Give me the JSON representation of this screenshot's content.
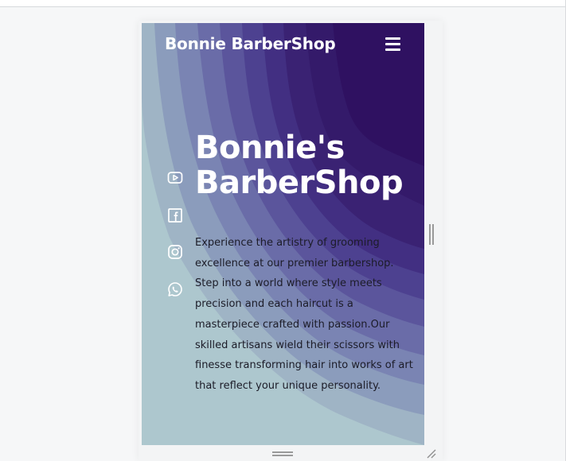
{
  "navbar": {
    "brand": "Bonnie BarberShop",
    "menu_icon": "hamburger-menu-icon"
  },
  "social": [
    {
      "name": "youtube",
      "icon": "youtube-icon"
    },
    {
      "name": "facebook",
      "icon": "facebook-icon"
    },
    {
      "name": "instagram",
      "icon": "instagram-icon"
    },
    {
      "name": "whatsapp",
      "icon": "whatsapp-icon"
    }
  ],
  "hero": {
    "title_line1": "Bonnie's",
    "title_line2": "BarberShop",
    "description": "Experience the artistry of grooming excellence at our premier barbershop. Step into a world where style meets precision and each haircut is a masterpiece crafted with passion.Our skilled artisans wield their scissors with finesse transforming hair into works of art that reflect your unique personality."
  },
  "colors": {
    "background_dark": "#2f0f5e",
    "background_light": "#adc7ce",
    "text_light": "#ffffff",
    "text_dark": "#1c1c28"
  }
}
